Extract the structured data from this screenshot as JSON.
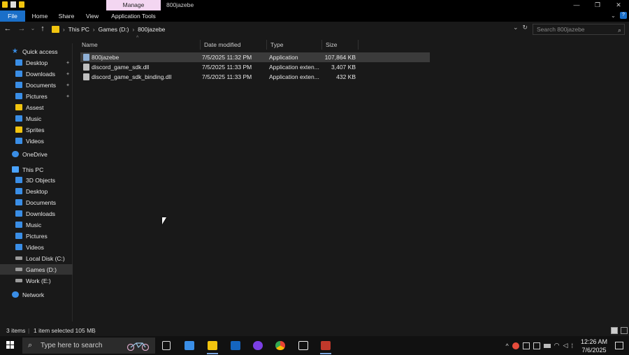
{
  "titlebar": {
    "manage_tab": "Manage",
    "window_title": "800jazebe",
    "controls": [
      "—",
      "❐",
      "✕"
    ]
  },
  "ribbon": {
    "tabs": [
      "File",
      "Home",
      "Share",
      "View",
      "Application Tools"
    ]
  },
  "address": {
    "back": "←",
    "forward": "→",
    "up": "↑",
    "crumbs": [
      "This PC",
      "Games (D:)",
      "800jazebe"
    ],
    "separator": "›",
    "dropdown": "⌄",
    "refresh": "↻",
    "search_placeholder": "Search 800jazebe",
    "search_icon": "⌕"
  },
  "sidebar": {
    "quick_access": "Quick access",
    "quick_items": [
      {
        "label": "Desktop",
        "pinned": true,
        "icon": "desktop-icon"
      },
      {
        "label": "Downloads",
        "pinned": true,
        "icon": "downloads-icon"
      },
      {
        "label": "Documents",
        "pinned": true,
        "icon": "documents-icon"
      },
      {
        "label": "Pictures",
        "pinned": true,
        "icon": "pictures-icon"
      },
      {
        "label": "Assest",
        "pinned": false,
        "icon": "folder-icon"
      },
      {
        "label": "Music",
        "pinned": false,
        "icon": "music-icon"
      },
      {
        "label": "Sprites",
        "pinned": false,
        "icon": "folder-icon"
      },
      {
        "label": "Videos",
        "pinned": false,
        "icon": "videos-icon"
      }
    ],
    "onedrive": "OneDrive",
    "this_pc": "This PC",
    "pc_items": [
      {
        "label": "3D Objects",
        "icon": "3d-objects-icon"
      },
      {
        "label": "Desktop",
        "icon": "desktop-icon"
      },
      {
        "label": "Documents",
        "icon": "documents-icon"
      },
      {
        "label": "Downloads",
        "icon": "downloads-icon"
      },
      {
        "label": "Music",
        "icon": "music-icon"
      },
      {
        "label": "Pictures",
        "icon": "pictures-icon"
      },
      {
        "label": "Videos",
        "icon": "videos-icon"
      },
      {
        "label": "Local Disk (C:)",
        "icon": "drive-icon"
      },
      {
        "label": "Games (D:)",
        "icon": "drive-icon",
        "selected": true
      },
      {
        "label": "Work (E:)",
        "icon": "drive-icon"
      }
    ],
    "network": "Network"
  },
  "files": {
    "columns": [
      "Name",
      "Date modified",
      "Type",
      "Size"
    ],
    "sort_indicator": "^",
    "rows": [
      {
        "name": "800jazebe",
        "date": "7/5/2025 11:32 PM",
        "type": "Application",
        "size": "107,864 KB",
        "selected": true,
        "icon": "application-icon"
      },
      {
        "name": "discord_game_sdk.dll",
        "date": "7/5/2025 11:33 PM",
        "type": "Application exten...",
        "size": "3,407 KB",
        "selected": false,
        "icon": "dll-file-icon"
      },
      {
        "name": "discord_game_sdk_binding.dll",
        "date": "7/5/2025 11:33 PM",
        "type": "Application exten...",
        "size": "432 KB",
        "selected": false,
        "icon": "dll-file-icon"
      }
    ]
  },
  "status": {
    "items_count": "3 items",
    "selection": "1 item selected  105 MB"
  },
  "taskbar": {
    "search_placeholder": "Type here to search",
    "time": "12:26 AM",
    "date": "7/6/2025"
  },
  "colors": {
    "accent": "#1a6fc9",
    "manage_tab": "#f3d6f1",
    "background": "#191919",
    "folder": "#f1c40f"
  }
}
